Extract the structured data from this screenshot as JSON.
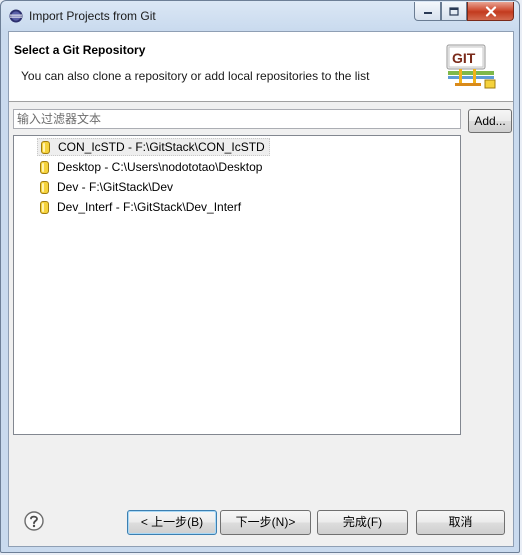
{
  "window": {
    "title": "Import Projects from Git"
  },
  "header": {
    "title": "Select a Git Repository",
    "description": "You can also clone a repository or add local repositories to the list",
    "logo_text": "GIT"
  },
  "filter": {
    "placeholder": "输入过滤器文本",
    "value": ""
  },
  "add_button_label": "Add...",
  "repositories": [
    {
      "label": "CON_IcSTD - F:\\GitStack\\CON_IcSTD",
      "selected": true
    },
    {
      "label": "Desktop - C:\\Users\\nodototao\\Desktop",
      "selected": false
    },
    {
      "label": "Dev - F:\\GitStack\\Dev",
      "selected": false
    },
    {
      "label": "Dev_Interf - F:\\GitStack\\Dev_Interf",
      "selected": false
    }
  ],
  "footer": {
    "help_icon": "question-mark-icon",
    "back_label": "< 上一步(B)",
    "next_label": "下一步(N)>",
    "finish_label": "完成(F)",
    "cancel_label": "取消"
  },
  "colors": {
    "repo_icon_fill": "#f5d23c",
    "repo_icon_stroke": "#a07d10",
    "close_button": "#c8432a",
    "default_button_border": "#3c7fb1"
  }
}
